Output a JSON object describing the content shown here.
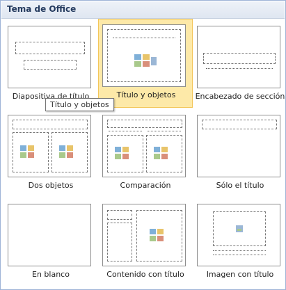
{
  "panel": {
    "title": "Tema de Office"
  },
  "layouts": [
    {
      "id": "title-slide",
      "label": "Diapositiva de título"
    },
    {
      "id": "title-content",
      "label": "Título y objetos"
    },
    {
      "id": "section-header",
      "label": "Encabezado de sección"
    },
    {
      "id": "two-content",
      "label": "Dos objetos"
    },
    {
      "id": "comparison",
      "label": "Comparación"
    },
    {
      "id": "title-only",
      "label": "Sólo el título"
    },
    {
      "id": "blank",
      "label": "En blanco"
    },
    {
      "id": "content-caption",
      "label": "Contenido con título"
    },
    {
      "id": "picture-caption",
      "label": "Imagen con título"
    }
  ],
  "selected_layout": "title-content",
  "tooltip": {
    "text": "Título y objetos"
  },
  "colors": {
    "selected_bg": "#fde9a8",
    "selected_border": "#f3c65a",
    "panel_border": "#9db3d6"
  }
}
